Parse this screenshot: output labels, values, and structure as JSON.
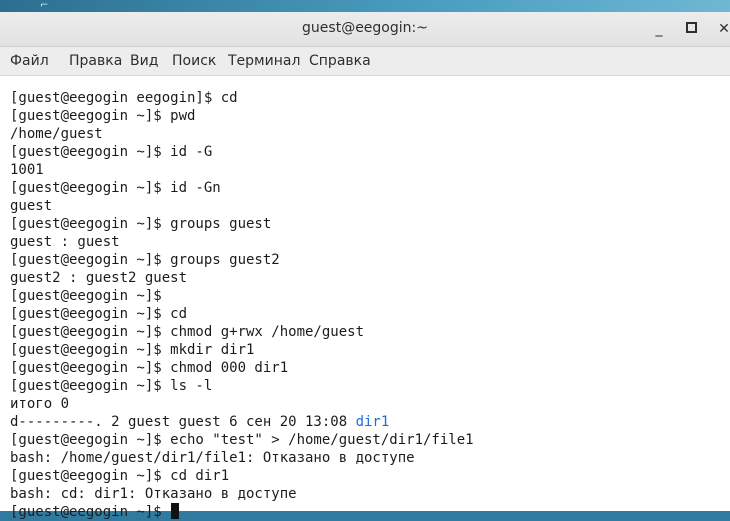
{
  "window": {
    "title": "guest@eegogin:~",
    "minimize_glyph": "_",
    "close_glyph": "✕"
  },
  "menu": [
    "Файл",
    "Правка",
    "Вид",
    "Поиск",
    "Терминал",
    "Справка"
  ],
  "terminal": {
    "lines": [
      "[guest@eegogin eegogin]$ cd",
      "[guest@eegogin ~]$ pwd",
      "/home/guest",
      "[guest@eegogin ~]$ id -G",
      "1001",
      "[guest@eegogin ~]$ id -Gn",
      "guest",
      "[guest@eegogin ~]$ groups guest",
      "guest : guest",
      "[guest@eegogin ~]$ groups guest2",
      "guest2 : guest2 guest",
      "[guest@eegogin ~]$",
      "[guest@eegogin ~]$ cd",
      "[guest@eegogin ~]$ chmod g+rwx /home/guest",
      "[guest@eegogin ~]$ mkdir dir1",
      "[guest@eegogin ~]$ chmod 000 dir1",
      "[guest@eegogin ~]$ ls -l",
      "итого 0",
      "d---------. 2 guest guest 6 сен 20 13:08 ",
      "[guest@eegogin ~]$ echo \"test\" > /home/guest/dir1/file1",
      "bash: /home/guest/dir1/file1: Отказано в доступе",
      "[guest@eegogin ~]$ cd dir1",
      "bash: cd: dir1: Отказано в доступе",
      "[guest@eegogin ~]$ "
    ],
    "highlighted_dir": "dir1",
    "dir_color": "#1f6bd3"
  }
}
